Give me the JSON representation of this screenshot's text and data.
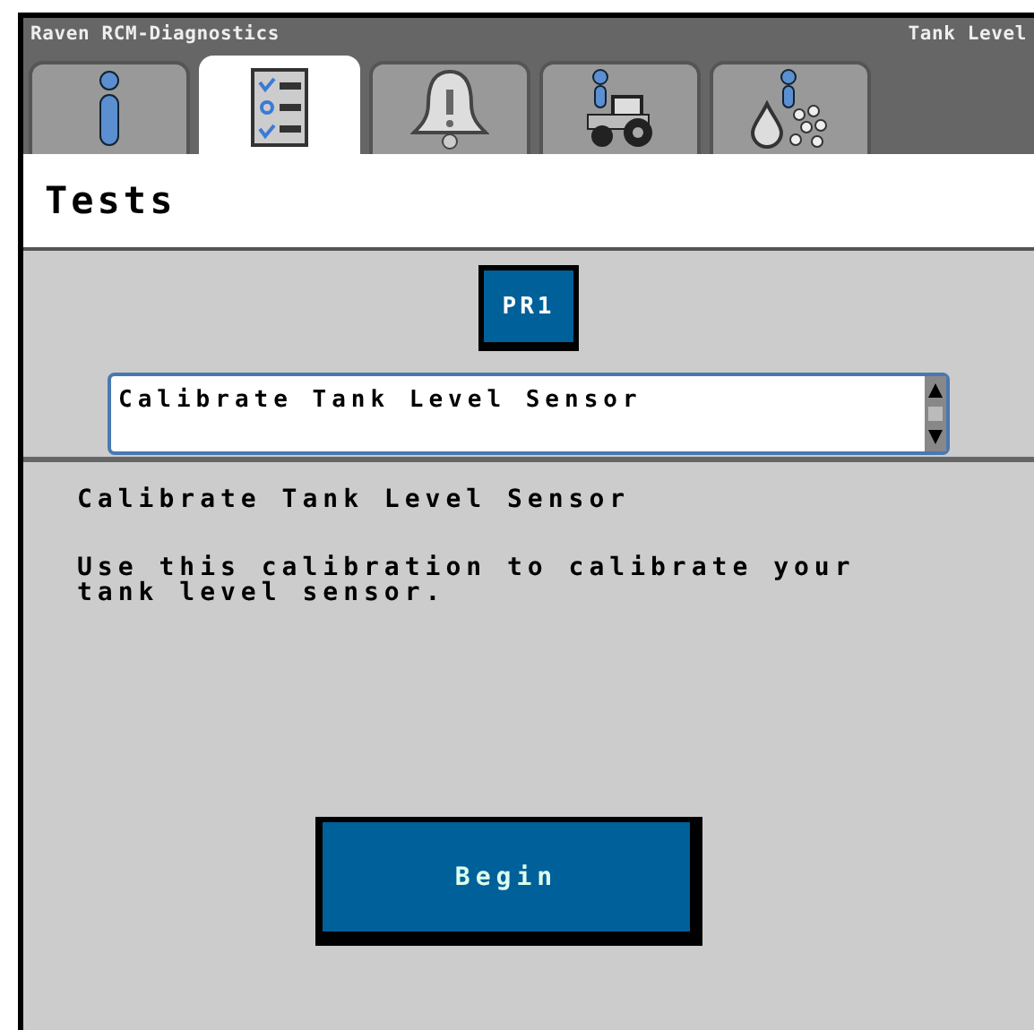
{
  "title_bar": {
    "app": "Raven RCM-Diagnostics",
    "context": "Tank Level"
  },
  "tabs": [
    {
      "kind": "info",
      "selected": false
    },
    {
      "kind": "checklist",
      "selected": true
    },
    {
      "kind": "alarm",
      "selected": false
    },
    {
      "kind": "machine",
      "selected": false
    },
    {
      "kind": "product",
      "selected": false
    }
  ],
  "page_title": "Tests",
  "product_button": "PR1",
  "test_select": {
    "value": "Calibrate Tank Level Sensor"
  },
  "description": {
    "heading": "Calibrate Tank Level Sensor",
    "body": "Use this calibration to calibrate your tank level sensor."
  },
  "begin_button": "Begin"
}
